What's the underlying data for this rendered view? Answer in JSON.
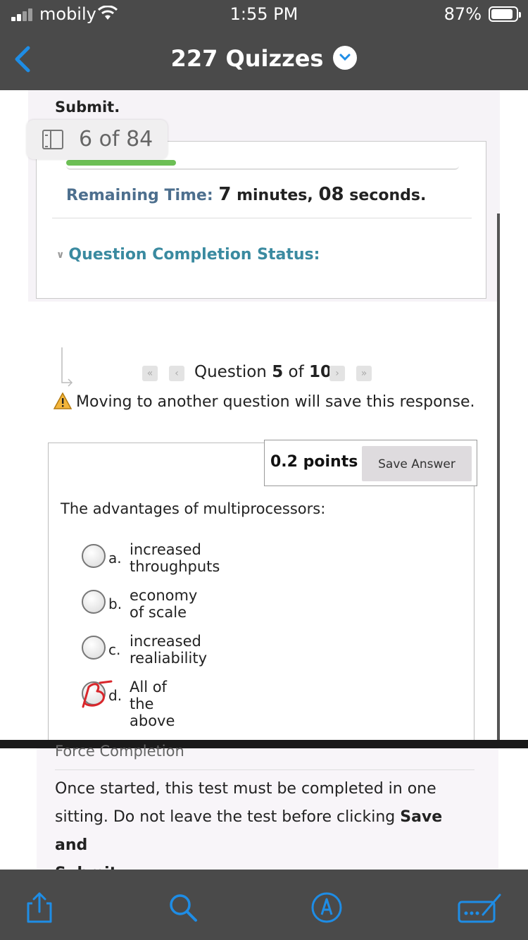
{
  "status_bar": {
    "carrier": "mobily",
    "time": "1:55 PM",
    "battery": "87%"
  },
  "nav": {
    "title": "227 Quizzes"
  },
  "page": {
    "submit_top": "Submit.",
    "page_counter": "6 of 84",
    "progress_fraction": 0.28,
    "remaining_label": "Remaining Time:",
    "remaining_minutes": "7",
    "remaining_minutes_unit": "minutes,",
    "remaining_seconds": "08",
    "remaining_seconds_unit": "seconds.",
    "completion_status": "Question Completion Status:",
    "question_nav": {
      "prefix": "Question",
      "current": "5",
      "of": "of",
      "total": "10"
    },
    "warning": "Moving to another question will save this response.",
    "points": "0.2 points",
    "save_answer": "Save Answer",
    "question": "The advantages of multiprocessors:",
    "options": [
      {
        "letter": "a.",
        "text": "increased throughputs",
        "selected": false
      },
      {
        "letter": "b.",
        "text": "economy of scale",
        "selected": false
      },
      {
        "letter": "c.",
        "text": "increased realiability",
        "selected": false
      },
      {
        "letter": "d.",
        "text": "All of the above",
        "selected": true
      }
    ],
    "force_heading": "Force Completion",
    "notice_part1": "Once started, this test must be completed in one sitting. Do not leave the test before clicking ",
    "notice_bold1": "Save and",
    "notice_bold2": "Submit",
    "notice_end": "."
  },
  "colors": {
    "header": "#4a4a4a",
    "accent_blue": "#1e8de6",
    "progress": "#6cbf55",
    "completion": "#3a8aa0"
  },
  "tabbar": {
    "icons": [
      "share-icon",
      "search-icon",
      "markup-icon",
      "keyboard-edit-icon"
    ]
  }
}
